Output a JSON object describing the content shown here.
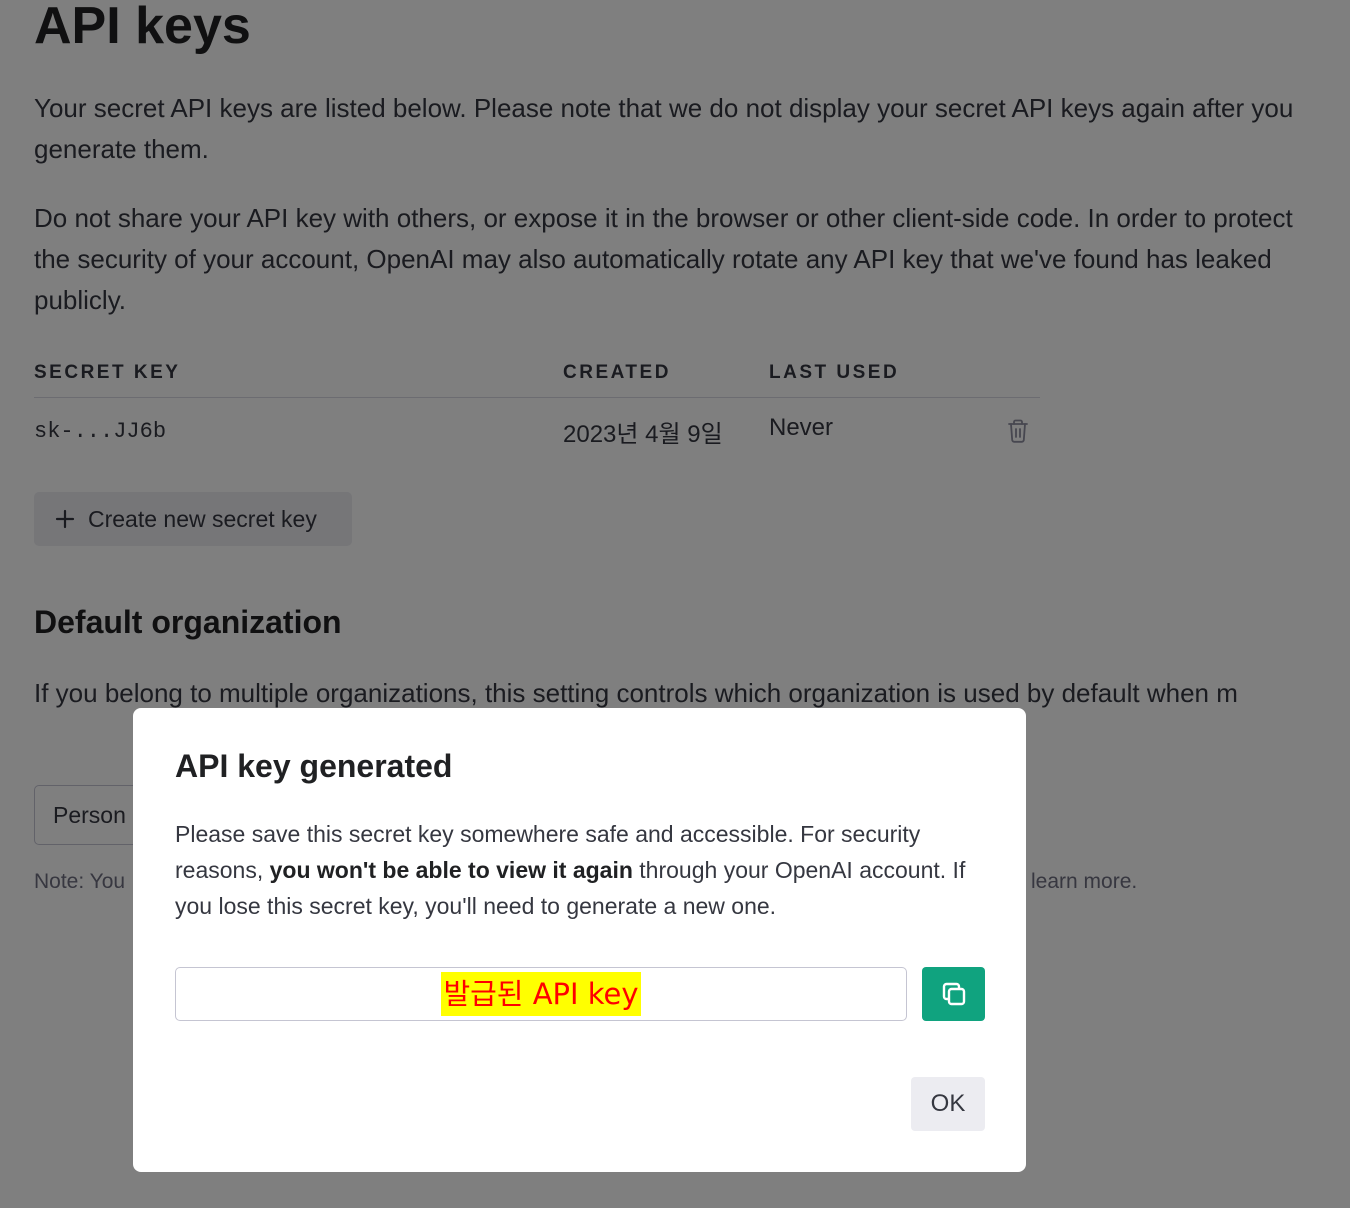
{
  "page": {
    "title": "API keys",
    "intro": "Your secret API keys are listed below. Please note that we do not display your secret API keys again after you generate them.",
    "warning": "Do not share your API key with others, or expose it in the browser or other client-side code. In order to protect the security of your account, OpenAI may also automatically rotate any API key that we've found has leaked publicly."
  },
  "keys_table": {
    "headers": {
      "secret_key": "SECRET KEY",
      "created": "CREATED",
      "last_used": "LAST USED"
    },
    "rows": [
      {
        "secret_key": "sk-...JJ6b",
        "created": "2023년 4월 9일",
        "last_used": "Never",
        "delete_icon": "trash-icon"
      }
    ]
  },
  "create_button": {
    "icon": "plus-icon",
    "label": "Create new secret key"
  },
  "default_org": {
    "title": "Default organization",
    "description": "If you belong to multiple organizations, this setting controls which organization is used by default when m",
    "select_value": "Person",
    "note_start": "Note: You",
    "note_end": "learn more."
  },
  "modal": {
    "title": "API key generated",
    "text_before": "Please save this secret key somewhere safe and accessible. For security reasons, ",
    "text_bold": "you won't be able to view it again",
    "text_after": " through your OpenAI account. If you lose this secret key, you'll need to generate a new one.",
    "key_field_value": "발급된 API key",
    "copy_icon": "copy-icon",
    "ok_label": "OK"
  },
  "colors": {
    "accent": "#10a37f",
    "overlay": "rgba(0,0,0,0.5)",
    "highlight_bg": "#ffff00",
    "highlight_text": "#ff0000"
  }
}
